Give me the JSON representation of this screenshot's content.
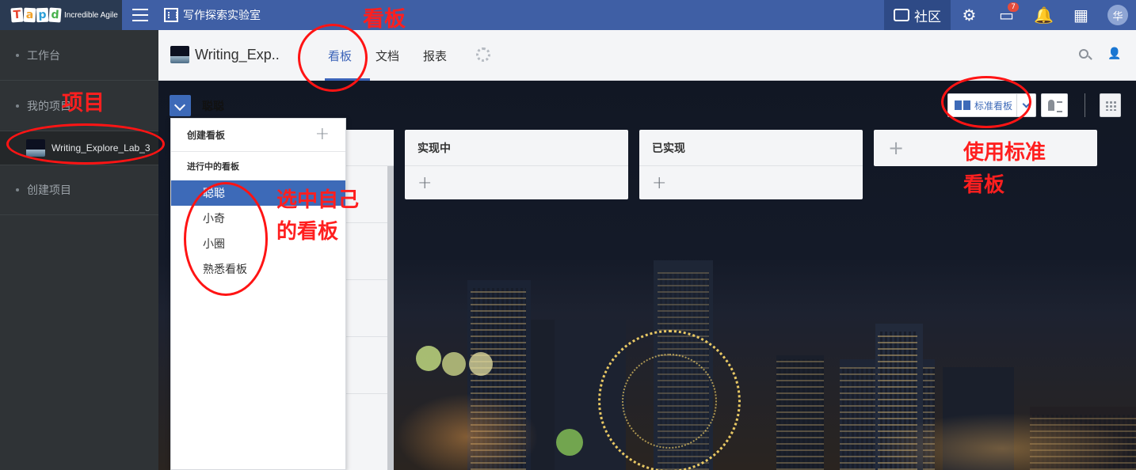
{
  "topbar": {
    "logo_letters": [
      "T",
      "a",
      "p",
      "d"
    ],
    "logo_tagline": "Incredible Agile",
    "company_name": "写作探索实验室",
    "community_label": "社区",
    "notification_badge": "7",
    "avatar_text": "华"
  },
  "sidebar": {
    "items": [
      {
        "label": "工作台"
      },
      {
        "label": "我的项目"
      },
      {
        "label": "创建项目"
      }
    ],
    "current_project": "Writing_Explore_Lab_3"
  },
  "project_header": {
    "name": "Writing_Exp..",
    "tabs": [
      {
        "label": "看板",
        "active": true
      },
      {
        "label": "文档",
        "active": false
      },
      {
        "label": "报表",
        "active": false
      }
    ]
  },
  "board": {
    "current_board": "聪聪",
    "view_button_label": "标准看板",
    "columns": [
      {
        "title": "实现中"
      },
      {
        "title": "已实现"
      }
    ]
  },
  "dropdown": {
    "create_label": "创建看板",
    "section_label": "进行中的看板",
    "boards": [
      {
        "label": "聪聪",
        "selected": true
      },
      {
        "label": "小奇",
        "selected": false
      },
      {
        "label": "小圈",
        "selected": false
      },
      {
        "label": "熟悉看板",
        "selected": false
      }
    ]
  },
  "annotations": {
    "board_tab": "看板",
    "project": "项目",
    "select_own_line1": "选中自己",
    "select_own_line2": "的看板",
    "use_standard_line1": "使用标准",
    "use_standard_line2": "看板"
  },
  "colors": {
    "accent": "#3d6ab8",
    "topbar": "#3f5fa5",
    "sidebar": "#2f3336",
    "annotation": "#ff1414"
  }
}
